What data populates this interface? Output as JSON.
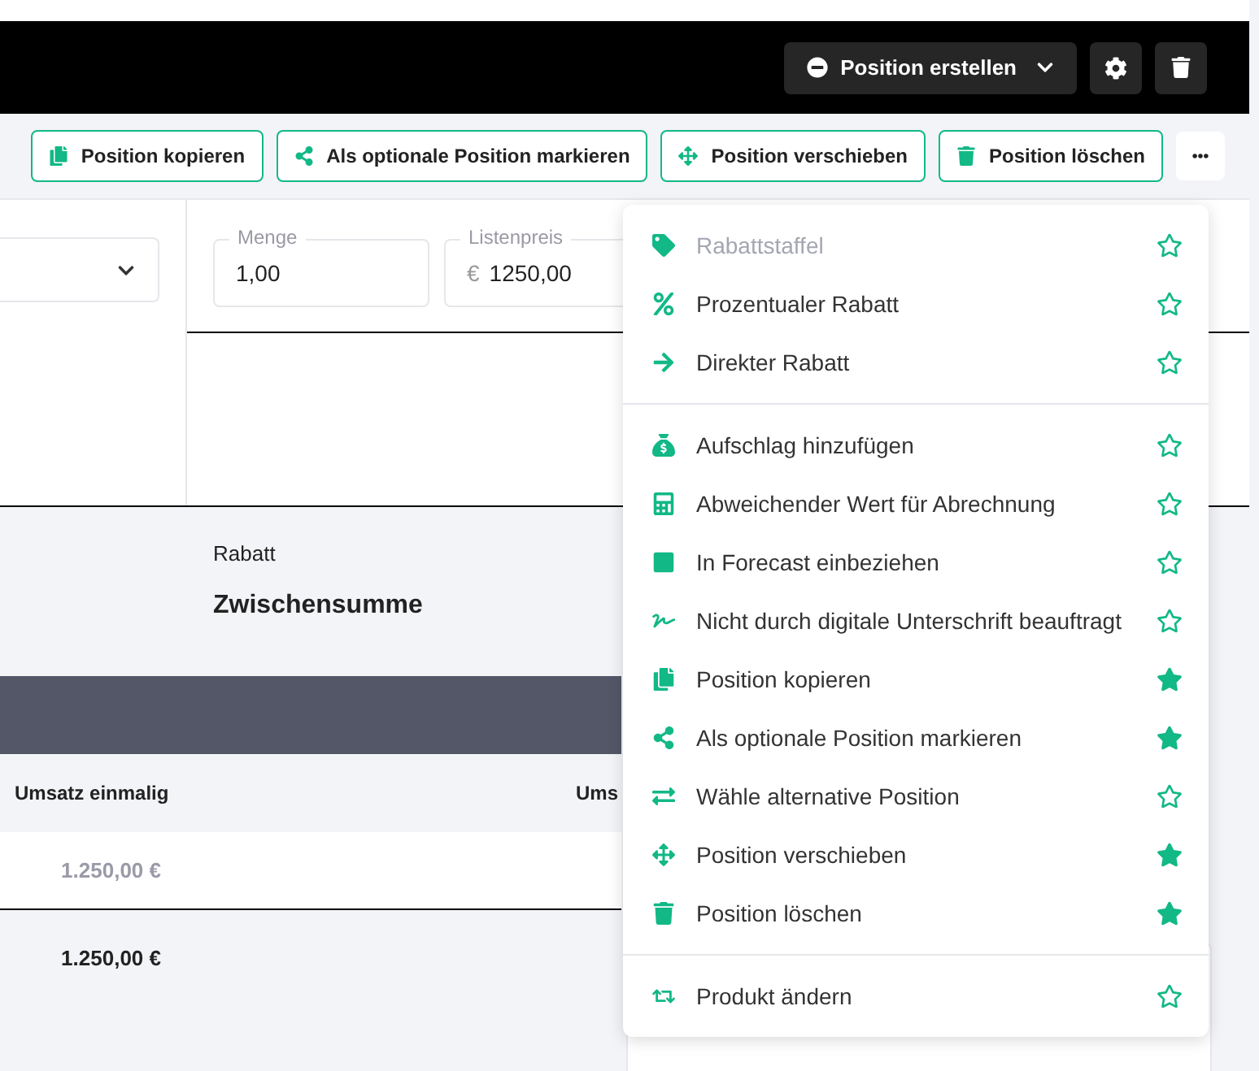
{
  "header": {
    "create_button": "Position erstellen"
  },
  "toolbar": {
    "buttons": [
      "Position kopieren",
      "Als optionale Position markieren",
      "Position verschieben",
      "Position löschen"
    ]
  },
  "fields": [
    {
      "label": "Menge",
      "value": "1,00"
    },
    {
      "label": "Listenpreis",
      "prefix": "€",
      "value": "1250,00"
    }
  ],
  "summary": {
    "discount_label": "Rabatt",
    "subtotal_label": "Zwischensumme"
  },
  "table": {
    "columns": [
      "Umsatz einmalig",
      "Ums"
    ],
    "row": "1.250,00 €",
    "total": "1.250,00 €"
  },
  "menu": {
    "groups": [
      [
        {
          "label": "Rabattstaffel",
          "disabled": true,
          "starred": false
        },
        {
          "label": "Prozentualer Rabatt",
          "disabled": false,
          "starred": false
        },
        {
          "label": "Direkter Rabatt",
          "disabled": false,
          "starred": false
        }
      ],
      [
        {
          "label": "Aufschlag hinzufügen",
          "disabled": false,
          "starred": false
        },
        {
          "label": "Abweichender Wert für Abrechnung",
          "disabled": false,
          "starred": false
        },
        {
          "label": "In Forecast einbeziehen",
          "disabled": false,
          "starred": false
        },
        {
          "label": "Nicht durch digitale Unterschrift beauftragt",
          "disabled": false,
          "starred": false
        },
        {
          "label": "Position kopieren",
          "disabled": false,
          "starred": true
        },
        {
          "label": "Als optionale Position markieren",
          "disabled": false,
          "starred": true
        },
        {
          "label": "Wähle alternative Position",
          "disabled": false,
          "starred": false
        },
        {
          "label": "Position verschieben",
          "disabled": false,
          "starred": true
        },
        {
          "label": "Position löschen",
          "disabled": false,
          "starred": true
        }
      ],
      [
        {
          "label": "Produkt ändern",
          "disabled": false,
          "starred": false
        }
      ]
    ]
  }
}
